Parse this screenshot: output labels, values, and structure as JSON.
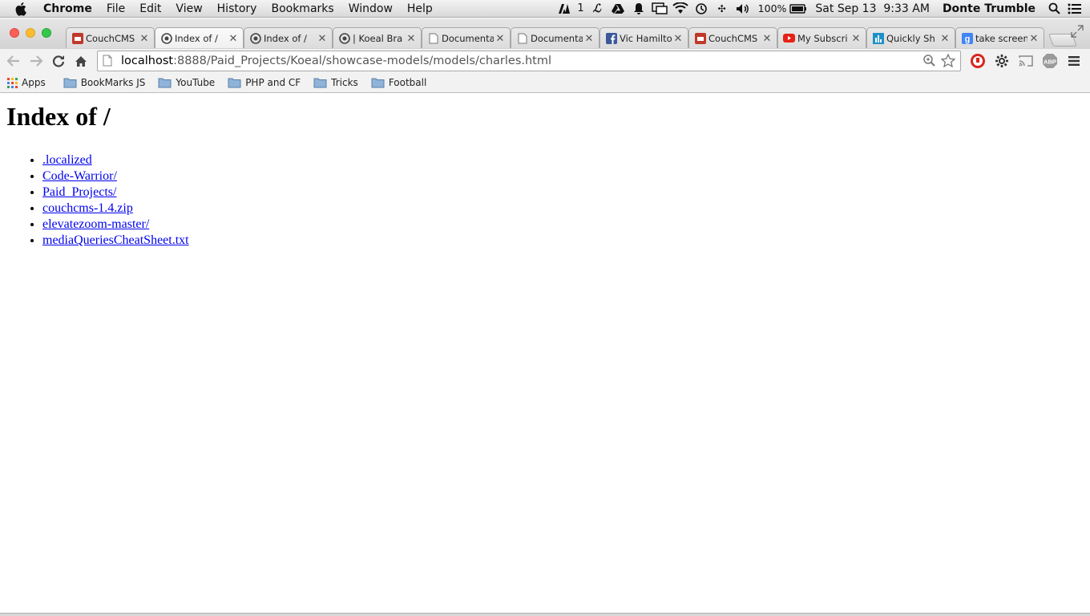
{
  "menubar": {
    "app_name": "Chrome",
    "menus": [
      "File",
      "Edit",
      "View",
      "History",
      "Bookmarks",
      "Window",
      "Help"
    ],
    "status": {
      "adobe_count": "1",
      "battery": "100%",
      "datetime": "Sat Sep 13  9:33 AM",
      "user": "Donte Trumble"
    }
  },
  "tabs": [
    {
      "title": "CouchCMS",
      "icon": "couchcms-icon",
      "active": false
    },
    {
      "title": "Index of /",
      "icon": "github-icon",
      "active": true
    },
    {
      "title": "Index of /",
      "icon": "github-icon",
      "active": false
    },
    {
      "title": "| Koeal Bra",
      "icon": "github-icon",
      "active": false
    },
    {
      "title": "Documenta",
      "icon": "page-icon",
      "active": false
    },
    {
      "title": "Documenta",
      "icon": "page-icon",
      "active": false
    },
    {
      "title": "Vic Hamilto",
      "icon": "facebook-icon",
      "active": false
    },
    {
      "title": "CouchCMS",
      "icon": "couchcms-icon",
      "active": false
    },
    {
      "title": "My Subscri",
      "icon": "youtube-icon",
      "active": false
    },
    {
      "title": "Quickly Sh",
      "icon": "chart-icon",
      "active": false
    },
    {
      "title": "take screen",
      "icon": "google-icon",
      "active": false
    }
  ],
  "address_bar": {
    "host": "localhost",
    "path": ":8888/Paid_Projects/Koeal/showcase-models/models/charles.html"
  },
  "bookmarks": [
    {
      "label": "Apps",
      "icon": "apps-grid-icon"
    },
    {
      "label": "BookMarks JS",
      "icon": "folder-icon"
    },
    {
      "label": "YouTube",
      "icon": "folder-icon"
    },
    {
      "label": "PHP and CF",
      "icon": "folder-icon"
    },
    {
      "label": "Tricks",
      "icon": "folder-icon"
    },
    {
      "label": "Football",
      "icon": "folder-icon"
    }
  ],
  "page": {
    "heading": "Index of /",
    "links": [
      ".localized",
      "Code-Warrior/",
      "Paid_Projects/",
      "couchcms-1.4.zip",
      "elevatezoom-master/",
      "mediaQueriesCheatSheet.txt"
    ]
  },
  "colors": {
    "link": "#0000ee",
    "youtube_red": "#e62117",
    "facebook_blue": "#3b5998",
    "couch_red": "#c0392b"
  }
}
